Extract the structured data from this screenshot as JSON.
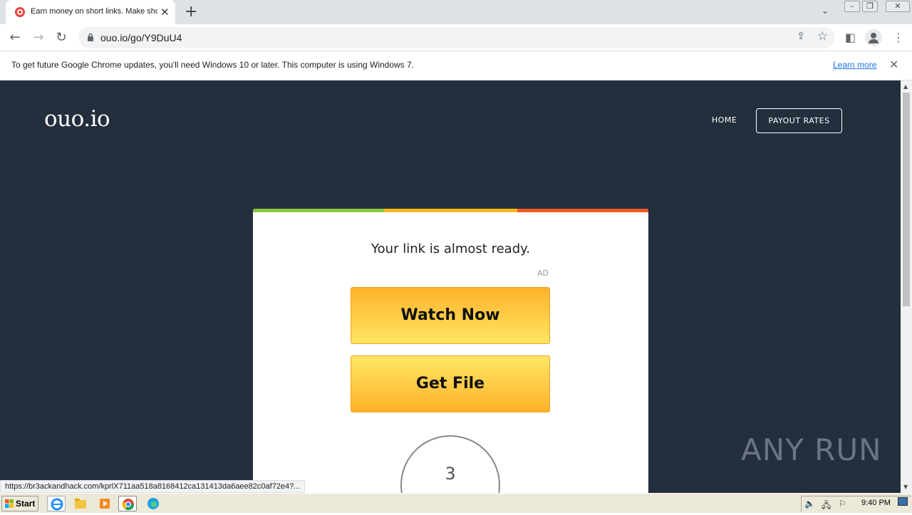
{
  "browser": {
    "tab_title": "Earn money on short links. Make short links and earn money",
    "new_tab_icon": "plus-icon",
    "url": "ouo.io/go/Y9DuU4",
    "status_url": "https://br3ackandhack.com/kprlX711aa518a8168412ca131413da6aee82c0af72e4?..."
  },
  "infobar": {
    "message": "To get future Google Chrome updates, you'll need Windows 10 or later. This computer is using Windows 7.",
    "learn_more": "Learn more"
  },
  "site": {
    "brand": "ouo.io",
    "nav": {
      "home": "HOME",
      "payout": "PAYOUT RATES"
    }
  },
  "card": {
    "headline": "Your link is almost ready.",
    "ad_label": "AD",
    "watch_now": "Watch Now",
    "get_file": "Get File",
    "countdown": "3",
    "bar_colors": [
      "#8dc63f",
      "#f7b718",
      "#f15a24"
    ]
  },
  "watermark": "ANY RUN",
  "taskbar": {
    "start": "Start",
    "clock": "9:40 PM"
  }
}
